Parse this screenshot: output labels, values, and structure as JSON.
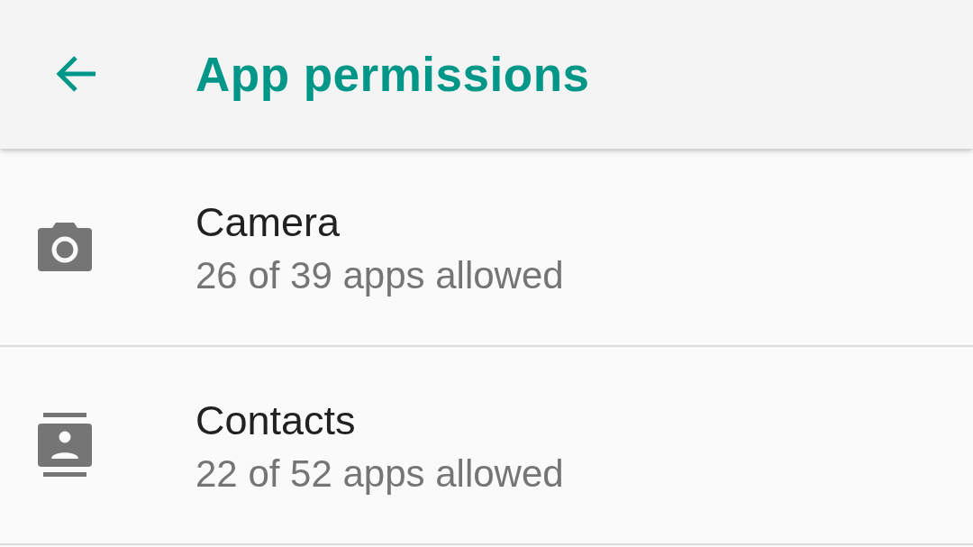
{
  "app_bar": {
    "title": "App permissions"
  },
  "permissions": [
    {
      "kind": "camera",
      "name": "Camera",
      "summary": "26 of 39 apps allowed"
    },
    {
      "kind": "contacts",
      "name": "Contacts",
      "summary": "22 of 52 apps allowed"
    }
  ]
}
